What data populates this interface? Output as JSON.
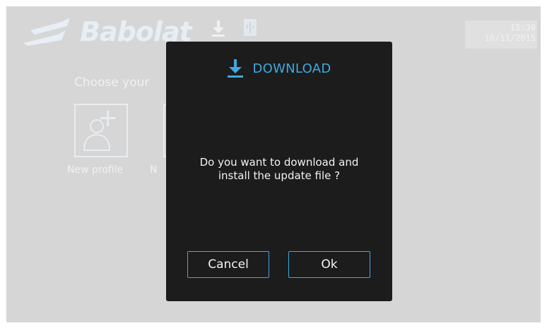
{
  "header": {
    "brand_name": "Babolat",
    "time": "15:39",
    "date": "16/11/2015"
  },
  "main": {
    "title": "Choose your",
    "profiles": [
      {
        "label": "New profile",
        "icon": "add-user-icon"
      },
      {
        "label": "N",
        "icon": "user-icon"
      }
    ]
  },
  "dialog": {
    "icon": "download-icon",
    "title": "DOWNLOAD",
    "message_line1": "Do you want to download and",
    "message_line2": "install the update file ?",
    "cancel_label": "Cancel",
    "ok_label": "Ok"
  },
  "colors": {
    "accent": "#3fa9e0",
    "dialog_background": "#1c1c1c",
    "screen_background": "#d6d6d6"
  }
}
